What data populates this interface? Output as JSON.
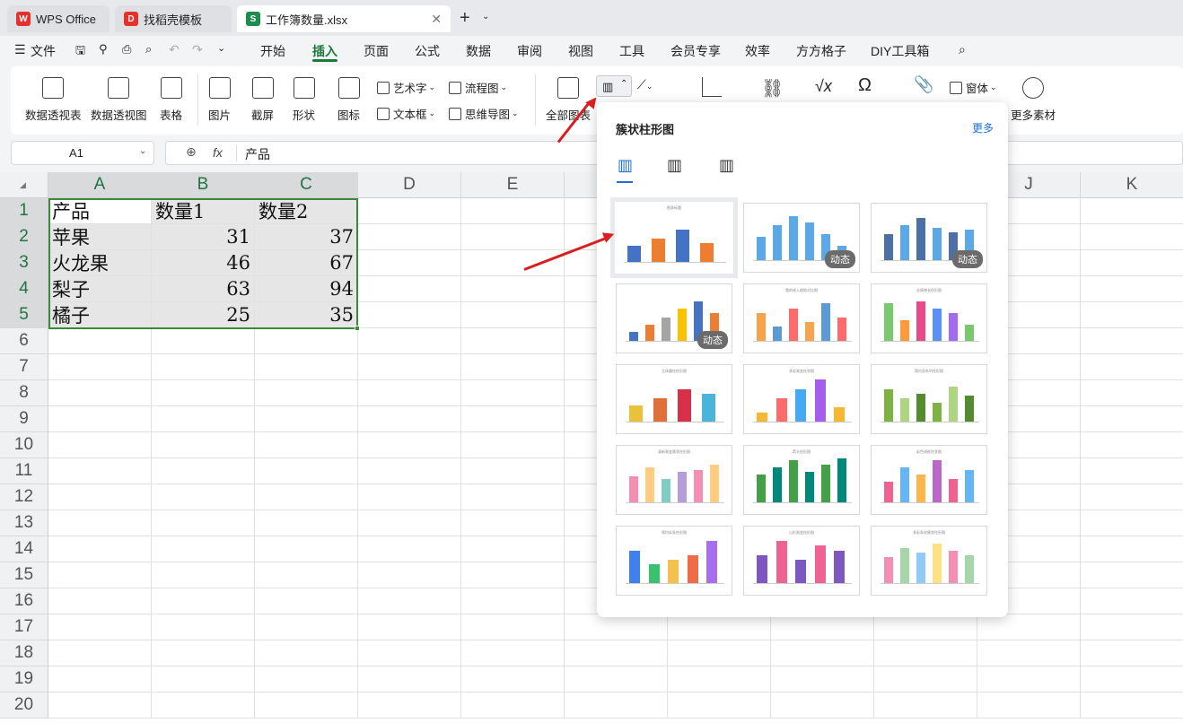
{
  "tabs": [
    {
      "label": "WPS Office",
      "logo": "W"
    },
    {
      "label": "找稻壳模板",
      "logo": "D"
    },
    {
      "label": "工作簿数量.xlsx",
      "logo": "S"
    }
  ],
  "menu": {
    "file": "文件",
    "items": [
      "开始",
      "插入",
      "页面",
      "公式",
      "数据",
      "审阅",
      "视图",
      "工具",
      "会员专享",
      "效率",
      "方方格子",
      "DIY工具箱"
    ],
    "active": "插入"
  },
  "ribbon": {
    "pivot_table": "数据透视表",
    "pivot_chart": "数据透视图",
    "table": "表格",
    "picture": "图片",
    "screenshot": "截屏",
    "shape": "形状",
    "icon": "图标",
    "art_text": "艺术字",
    "text_box": "文本框",
    "flowchart": "流程图",
    "mindmap": "思维导图",
    "all_charts": "全部图表",
    "window": "窗体",
    "more_material": "更多素材"
  },
  "formula_bar": {
    "cell_ref": "A1",
    "fx": "fx",
    "value": "产品"
  },
  "columns": [
    "A",
    "B",
    "C",
    "D",
    "E",
    "F",
    "G",
    "H",
    "I",
    "J",
    "K"
  ],
  "rows": [
    "1",
    "2",
    "3",
    "4",
    "5",
    "6",
    "7",
    "8",
    "9",
    "10",
    "11",
    "12",
    "13",
    "14",
    "15",
    "16",
    "17",
    "18",
    "19",
    "20"
  ],
  "sheet": {
    "header": [
      "产品",
      "数量1",
      "数量2"
    ],
    "data": [
      [
        "苹果",
        "31",
        "37"
      ],
      [
        "火龙果",
        "46",
        "67"
      ],
      [
        "梨子",
        "63",
        "94"
      ],
      [
        "橘子",
        "25",
        "35"
      ]
    ]
  },
  "popup": {
    "title": "簇状柱形图",
    "more": "更多",
    "badge": "动态",
    "thumb_titles": [
      "图表标题",
      "",
      "",
      "",
      "我的收入趋势对比图",
      "业绩增长柱形图",
      "立体圆柱柱形图",
      "多彩渐变柱状图",
      "简约双系列柱形图",
      "清新渐变簇状柱形图",
      "箭头柱形图",
      "彩色线框柱状图",
      "简约彩条柱形图",
      "山形渐变柱形图",
      "多彩条纹簇状柱形图"
    ]
  },
  "colors": {
    "accent_green": "#217346",
    "selection_green": "#3a8a3a",
    "arrow_red": "#d81e1e",
    "blue_link": "#1e6fd9"
  }
}
